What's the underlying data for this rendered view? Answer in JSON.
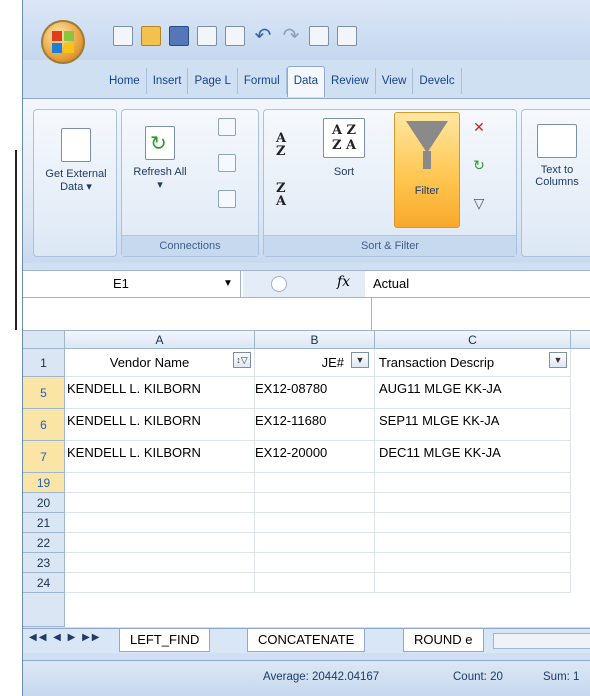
{
  "quick_access": [
    "new-icon",
    "open-icon",
    "save-icon",
    "copy-icon",
    "paste-icon",
    "undo-icon",
    "redo-icon",
    "preview-icon",
    "print-icon"
  ],
  "tabs": [
    "Home",
    "Insert",
    "Page L",
    "Formul",
    "Data",
    "Review",
    "View",
    "Develc"
  ],
  "active_tab": "Data",
  "ribbon": {
    "get_external_data": "Get External Data ▾",
    "refresh_all": "Refresh All ▾",
    "connections_label": "Connections",
    "sort": "Sort",
    "filter": "Filter",
    "sort_filter_label": "Sort & Filter",
    "text_to_columns": "Text to Columns",
    "sort_az": "A Z",
    "sort_za": "Z A"
  },
  "formula_bar": {
    "name_box": "E1",
    "fx": "fx",
    "value": "Actual"
  },
  "columns": [
    "A",
    "B",
    "C"
  ],
  "header_row": {
    "row_num": "1",
    "vendor": "Vendor Name",
    "je": "JE#",
    "desc": "Transaction Descrip"
  },
  "rows": [
    {
      "num": "5",
      "vendor": "KENDELL L. KILBORN",
      "je": "EX12-08780",
      "desc": "AUG11 MLGE KK-JA"
    },
    {
      "num": "6",
      "vendor": "KENDELL L. KILBORN",
      "je": "EX12-11680",
      "desc": "SEP11 MLGE KK-JA"
    },
    {
      "num": "7",
      "vendor": "KENDELL L. KILBORN",
      "je": "EX12-20000",
      "desc": "DEC11 MLGE KK-JA"
    },
    {
      "num": "19"
    },
    {
      "num": "20"
    },
    {
      "num": "21"
    },
    {
      "num": "22"
    },
    {
      "num": "23"
    },
    {
      "num": "24"
    }
  ],
  "sheet_tabs": [
    "LEFT_FIND",
    "CONCATENATE",
    "ROUND e"
  ],
  "status": {
    "average": "Average: 20442.04167",
    "count": "Count: 20",
    "sum": "Sum: 1"
  }
}
